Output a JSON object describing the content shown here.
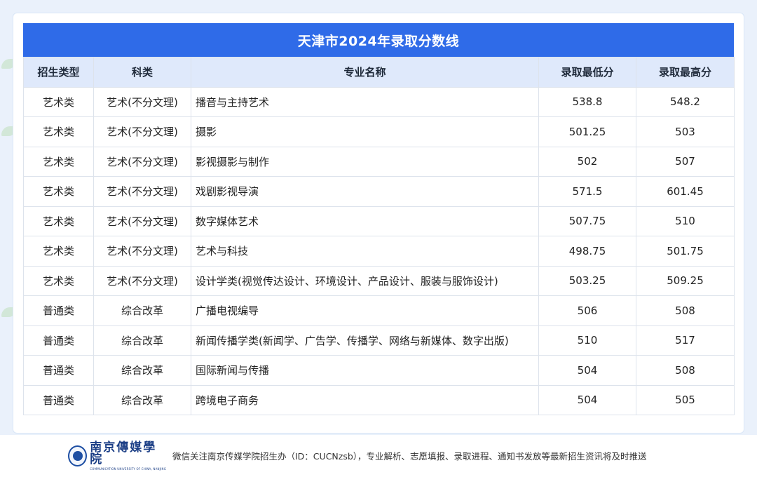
{
  "title": "天津市2024年录取分数线",
  "table": {
    "headers": {
      "type": "招生类型",
      "subject": "科类",
      "major": "专业名称",
      "min": "录取最低分",
      "max": "录取最高分"
    },
    "rows": [
      {
        "type": "艺术类",
        "subject": "艺术(不分文理)",
        "major": "播音与主持艺术",
        "min": "538.8",
        "max": "548.2"
      },
      {
        "type": "艺术类",
        "subject": "艺术(不分文理)",
        "major": "摄影",
        "min": "501.25",
        "max": "503"
      },
      {
        "type": "艺术类",
        "subject": "艺术(不分文理)",
        "major": "影视摄影与制作",
        "min": "502",
        "max": "507"
      },
      {
        "type": "艺术类",
        "subject": "艺术(不分文理)",
        "major": "戏剧影视导演",
        "min": "571.5",
        "max": "601.45"
      },
      {
        "type": "艺术类",
        "subject": "艺术(不分文理)",
        "major": "数字媒体艺术",
        "min": "507.75",
        "max": "510"
      },
      {
        "type": "艺术类",
        "subject": "艺术(不分文理)",
        "major": "艺术与科技",
        "min": "498.75",
        "max": "501.75"
      },
      {
        "type": "艺术类",
        "subject": "艺术(不分文理)",
        "major": "设计学类(视觉传达设计、环境设计、产品设计、服装与服饰设计)",
        "min": "503.25",
        "max": "509.25"
      },
      {
        "type": "普通类",
        "subject": "综合改革",
        "major": "广播电视编导",
        "min": "506",
        "max": "508"
      },
      {
        "type": "普通类",
        "subject": "综合改革",
        "major": "新闻传播学类(新闻学、广告学、传播学、网络与新媒体、数字出版)",
        "min": "510",
        "max": "517"
      },
      {
        "type": "普通类",
        "subject": "综合改革",
        "major": "国际新闻与传播",
        "min": "504",
        "max": "508"
      },
      {
        "type": "普通类",
        "subject": "综合改革",
        "major": "跨境电子商务",
        "min": "504",
        "max": "505"
      }
    ]
  },
  "footer": {
    "logo_name": "南京傳媒學院",
    "logo_en": "COMMUNICATION UNIVERSITY OF CHINA, NANJING",
    "text": "微信关注南京传媒学院招生办（ID：CUCNzsb），专业解析、志愿填报、录取进程、通知书发放等最新招生资讯将及时推送"
  },
  "colors": {
    "title_bar": "#2f6be8",
    "header_bg": "#dfe9fb",
    "page_bg": "#eaf1fb",
    "logo": "#1c3f86"
  },
  "icons": {
    "logo": "university-emblem-icon"
  }
}
